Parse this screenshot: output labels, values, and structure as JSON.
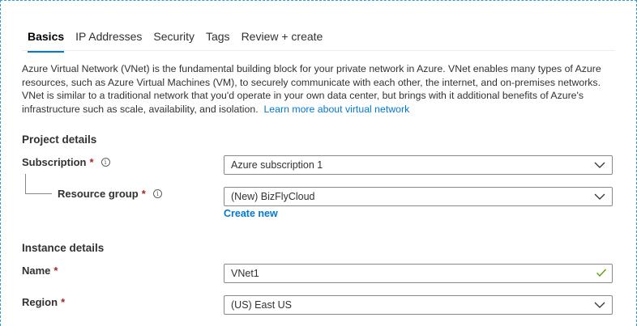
{
  "tabs": [
    {
      "label": "Basics",
      "active": true
    },
    {
      "label": "IP Addresses",
      "active": false
    },
    {
      "label": "Security",
      "active": false
    },
    {
      "label": "Tags",
      "active": false
    },
    {
      "label": "Review + create",
      "active": false
    }
  ],
  "description": {
    "text": "Azure Virtual Network (VNet) is the fundamental building block for your private network in Azure. VNet enables many types of Azure resources, such as Azure Virtual Machines (VM), to securely communicate with each other, the internet, and on-premises networks. VNet is similar to a traditional network that you'd operate in your own data center, but brings with it additional benefits of Azure's infrastructure such as scale, availability, and isolation.",
    "link": "Learn more about virtual network"
  },
  "project_details": {
    "title": "Project details",
    "subscription": {
      "label": "Subscription",
      "required": "*",
      "value": "Azure subscription 1"
    },
    "resource_group": {
      "label": "Resource group",
      "required": "*",
      "value": "(New) BizFlyCloud",
      "create_new": "Create new"
    }
  },
  "instance_details": {
    "title": "Instance details",
    "name": {
      "label": "Name",
      "required": "*",
      "value": "VNet1"
    },
    "region": {
      "label": "Region",
      "required": "*",
      "value": "(US) East US"
    }
  },
  "icons": {
    "info": "info-icon",
    "dropdown": "chevron-down-icon",
    "valid": "checkmark-icon"
  },
  "colors": {
    "accent": "#0078d4",
    "required": "#a4262c",
    "valid": "#57a300",
    "frame": "#2a9fd6"
  }
}
